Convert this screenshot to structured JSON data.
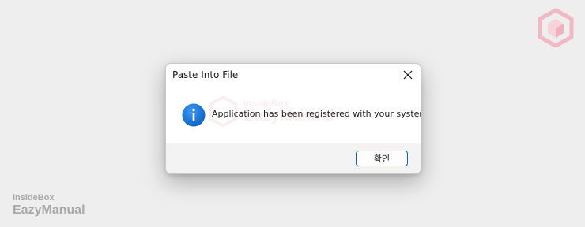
{
  "dialog": {
    "title": "Paste Into File",
    "message": "Application has been registered with your system",
    "ok_label": "확인",
    "icon": "info-icon",
    "close_icon": "close-icon"
  },
  "watermark": {
    "small": "insideBox",
    "big": "EazyManual"
  },
  "colors": {
    "accent": "#0067c0",
    "info_icon": "#1a73d9",
    "logo_pink": "#e8a4b4"
  }
}
